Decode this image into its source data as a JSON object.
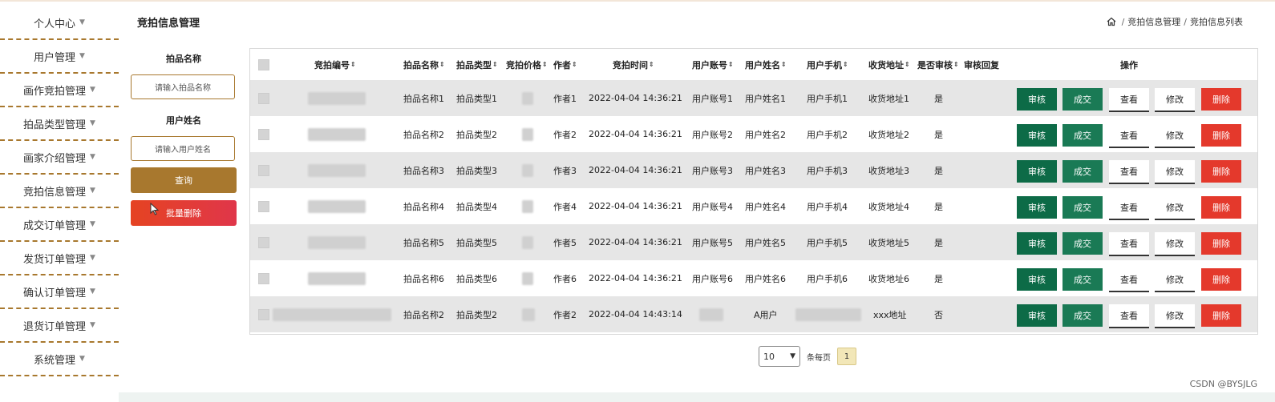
{
  "sidebar": {
    "items": [
      {
        "label": "个人中心"
      },
      {
        "label": "用户管理"
      },
      {
        "label": "画作竞拍管理"
      },
      {
        "label": "拍品类型管理"
      },
      {
        "label": "画家介绍管理"
      },
      {
        "label": "竞拍信息管理"
      },
      {
        "label": "成交订单管理"
      },
      {
        "label": "发货订单管理"
      },
      {
        "label": "确认订单管理"
      },
      {
        "label": "退货订单管理"
      },
      {
        "label": "系统管理"
      }
    ]
  },
  "header": {
    "title": "竞拍信息管理",
    "breadcrumb": [
      "竞拍信息管理",
      "竞拍信息列表"
    ]
  },
  "search": {
    "field1_label": "拍品名称",
    "field1_placeholder": "请输入拍品名称",
    "field2_label": "用户姓名",
    "field2_placeholder": "请输入用户姓名",
    "query_label": "查询",
    "batch_delete_label": "批量删除"
  },
  "table": {
    "headers": {
      "bid_no": "竞拍编号",
      "item_name": "拍品名称",
      "item_type": "拍品类型",
      "price": "竞拍价格",
      "author": "作者",
      "bid_time": "竞拍时间",
      "account": "用户账号",
      "user_name": "用户姓名",
      "phone": "用户手机",
      "address": "收货地址",
      "audited": "是否审核",
      "reply": "审核回复",
      "actions": "操作"
    },
    "buttons": {
      "audit": "审核",
      "deal": "成交",
      "view": "查看",
      "edit": "修改",
      "delete": "删除"
    },
    "rows": [
      {
        "item_name": "拍品名称1",
        "item_type": "拍品类型1",
        "author": "作者1",
        "bid_time": "2022-04-04 14:36:21",
        "account": "用户账号1",
        "user_name": "用户姓名1",
        "phone": "用户手机1",
        "address": "收货地址1",
        "audited": "是"
      },
      {
        "item_name": "拍品名称2",
        "item_type": "拍品类型2",
        "author": "作者2",
        "bid_time": "2022-04-04 14:36:21",
        "account": "用户账号2",
        "user_name": "用户姓名2",
        "phone": "用户手机2",
        "address": "收货地址2",
        "audited": "是"
      },
      {
        "item_name": "拍品名称3",
        "item_type": "拍品类型3",
        "author": "作者3",
        "bid_time": "2022-04-04 14:36:21",
        "account": "用户账号3",
        "user_name": "用户姓名3",
        "phone": "用户手机3",
        "address": "收货地址3",
        "audited": "是"
      },
      {
        "item_name": "拍品名称4",
        "item_type": "拍品类型4",
        "author": "作者4",
        "bid_time": "2022-04-04 14:36:21",
        "account": "用户账号4",
        "user_name": "用户姓名4",
        "phone": "用户手机4",
        "address": "收货地址4",
        "audited": "是"
      },
      {
        "item_name": "拍品名称5",
        "item_type": "拍品类型5",
        "author": "作者5",
        "bid_time": "2022-04-04 14:36:21",
        "account": "用户账号5",
        "user_name": "用户姓名5",
        "phone": "用户手机5",
        "address": "收货地址5",
        "audited": "是"
      },
      {
        "item_name": "拍品名称6",
        "item_type": "拍品类型6",
        "author": "作者6",
        "bid_time": "2022-04-04 14:36:21",
        "account": "用户账号6",
        "user_name": "用户姓名6",
        "phone": "用户手机6",
        "address": "收货地址6",
        "audited": "是"
      },
      {
        "item_name": "拍品名称2",
        "item_type": "拍品类型2",
        "author": "作者2",
        "bid_time": "2022-04-04 14:43:14",
        "account": "",
        "user_name": "A用户",
        "phone": "",
        "address": "xxx地址",
        "audited": "否"
      }
    ]
  },
  "pagination": {
    "page_size": "10",
    "per_page_label": "条每页",
    "current_page": "1"
  },
  "watermark": "CSDN @BYSJLG",
  "colors": {
    "accent": "#a8782e",
    "audit_button": "#0d6b47",
    "delete_button": "#e4392c"
  }
}
